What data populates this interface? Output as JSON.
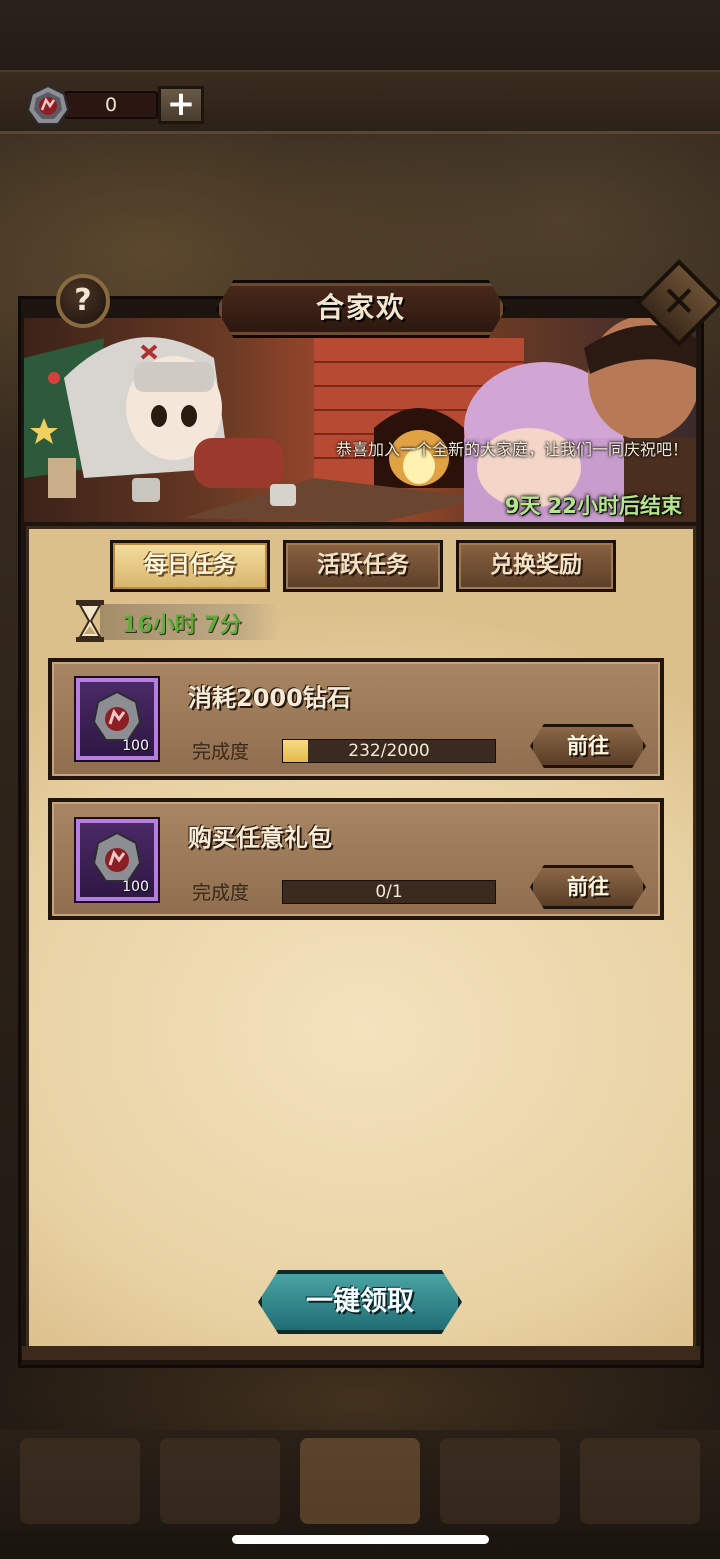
{
  "resources": {
    "gem_count": "0",
    "add_label": "+"
  },
  "modal": {
    "title": "合家欢",
    "help_label": "?",
    "close_label": "✕",
    "banner": {
      "message": "恭喜加入一个全新的大家庭，让我们一同庆祝吧！",
      "timer": "9天 22小时后结束"
    }
  },
  "tabs": [
    {
      "label": "每日任务",
      "active": true
    },
    {
      "label": "活跃任务",
      "active": false
    },
    {
      "label": "兑换奖励",
      "active": false
    }
  ],
  "countdown": "16小时 7分",
  "progress_label": "完成度",
  "tasks": [
    {
      "title": "消耗2000钻石",
      "reward_qty": "100",
      "progress_text": "232/2000",
      "progress_current": 232,
      "progress_total": 2000,
      "go_label": "前往"
    },
    {
      "title": "购买任意礼包",
      "reward_qty": "100",
      "progress_text": "0/1",
      "progress_current": 0,
      "progress_total": 1,
      "go_label": "前往"
    }
  ],
  "claim_all_label": "一键领取",
  "colors": {
    "parchment": "#ead5a8",
    "active_tab": "#e2c47e",
    "task_card": "#9a7857",
    "reward_frame": "#b77ee0",
    "claim_button": "#2f8b8f",
    "timer_green": "#b5e58a"
  },
  "icons": {
    "resource": "gem-crest-icon",
    "help": "question-icon",
    "close": "close-icon",
    "countdown": "hourglass-icon",
    "reward": "gem-crest-icon"
  }
}
